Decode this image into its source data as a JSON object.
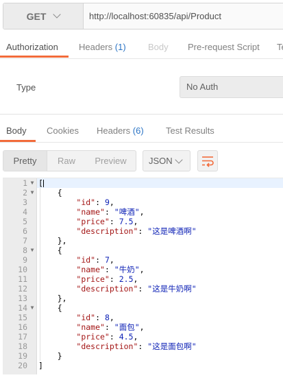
{
  "request": {
    "method": "GET",
    "url": "http://localhost:60835/api/Product"
  },
  "request_tabs": [
    {
      "label": "Authorization",
      "count": ""
    },
    {
      "label": "Headers",
      "count": "(1)"
    },
    {
      "label": "Body",
      "count": ""
    },
    {
      "label": "Pre-request Script",
      "count": ""
    },
    {
      "label": "Te",
      "count": ""
    }
  ],
  "authorization": {
    "type_label": "Type",
    "type_value": "No Auth"
  },
  "response_tabs": [
    {
      "label": "Body",
      "count": ""
    },
    {
      "label": "Cookies",
      "count": ""
    },
    {
      "label": "Headers",
      "count": "(6)"
    },
    {
      "label": "Test Results",
      "count": ""
    }
  ],
  "format_buttons": [
    "Pretty",
    "Raw",
    "Preview"
  ],
  "format_select": "JSON",
  "code_lines": [
    {
      "n": "1",
      "text": "["
    },
    {
      "n": "2",
      "text": "    {"
    },
    {
      "n": "3",
      "text": "        \"id\": 9,"
    },
    {
      "n": "4",
      "text": "        \"name\": \"啤酒\","
    },
    {
      "n": "5",
      "text": "        \"price\": 7.5,"
    },
    {
      "n": "6",
      "text": "        \"description\": \"这是啤酒啊\""
    },
    {
      "n": "7",
      "text": "    },"
    },
    {
      "n": "8",
      "text": "    {"
    },
    {
      "n": "9",
      "text": "        \"id\": 7,"
    },
    {
      "n": "10",
      "text": "        \"name\": \"牛奶\","
    },
    {
      "n": "11",
      "text": "        \"price\": 2.5,"
    },
    {
      "n": "12",
      "text": "        \"description\": \"这是牛奶啊\""
    },
    {
      "n": "13",
      "text": "    },"
    },
    {
      "n": "14",
      "text": "    {"
    },
    {
      "n": "15",
      "text": "        \"id\": 8,"
    },
    {
      "n": "16",
      "text": "        \"name\": \"面包\","
    },
    {
      "n": "17",
      "text": "        \"price\": 4.5,"
    },
    {
      "n": "18",
      "text": "        \"description\": \"这是面包啊\""
    },
    {
      "n": "19",
      "text": "    }"
    },
    {
      "n": "20",
      "text": "]"
    }
  ],
  "colors": {
    "accent_orange": "#f26b3a",
    "count_blue": "#2b74c5",
    "json_key": "#a31515",
    "json_value": "#0b1fb5"
  }
}
